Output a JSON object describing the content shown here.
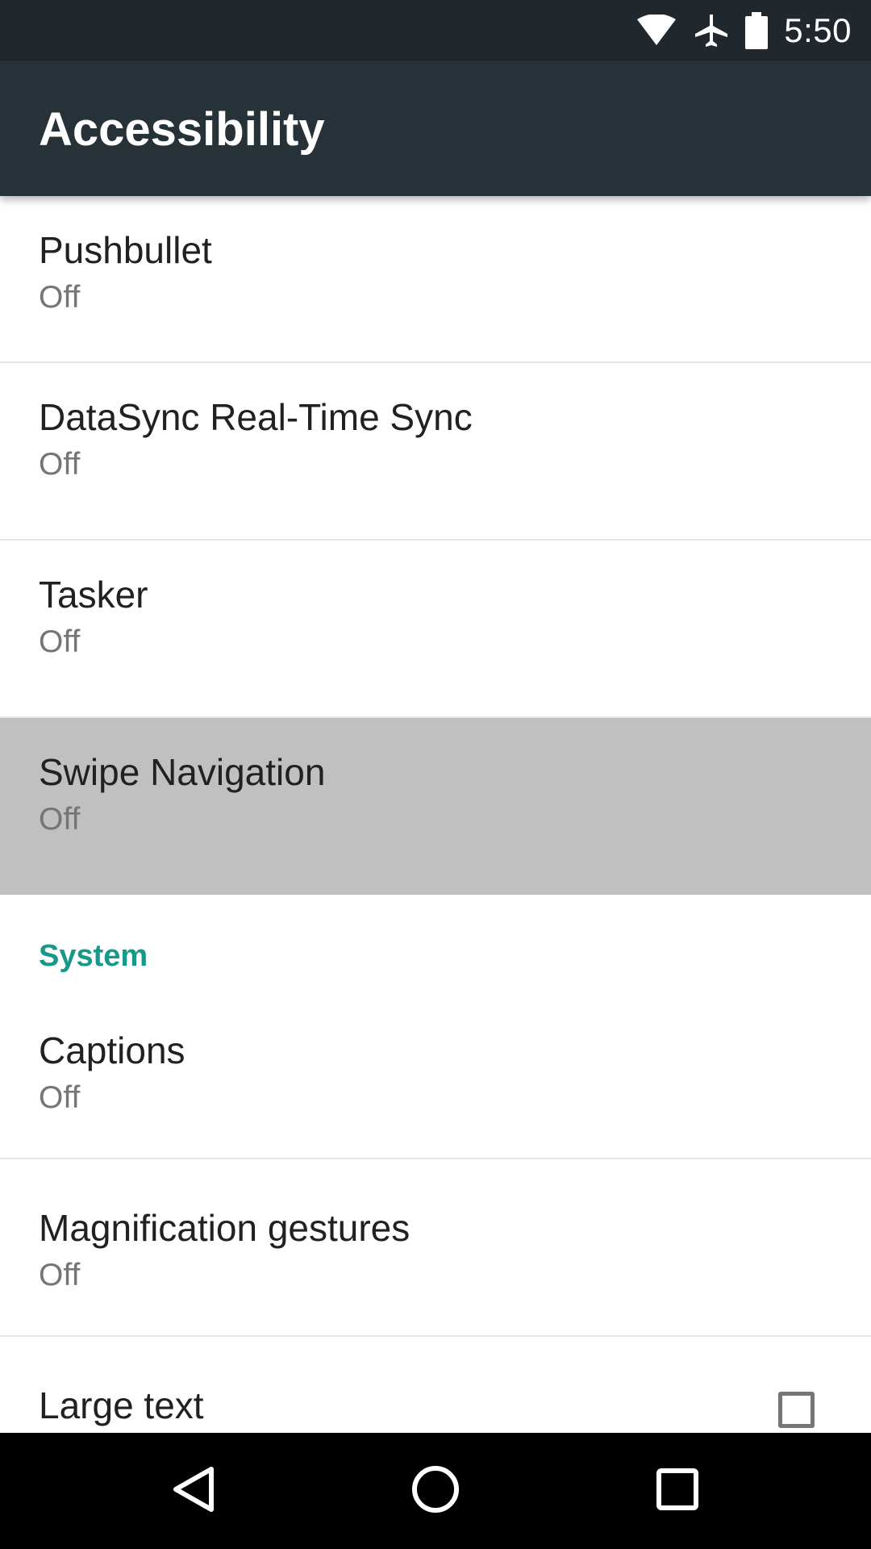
{
  "status_bar": {
    "time": "5:50",
    "icons": [
      "wifi-icon",
      "airplane-mode-icon",
      "battery-icon"
    ]
  },
  "app_bar": {
    "title": "Accessibility"
  },
  "services": [
    {
      "title": "Pushbullet",
      "summary": "Off"
    },
    {
      "title": "DataSync Real-Time Sync",
      "summary": "Off"
    },
    {
      "title": "Tasker",
      "summary": "Off"
    },
    {
      "title": "Swipe Navigation",
      "summary": "Off"
    }
  ],
  "system": {
    "header": "System",
    "items": [
      {
        "title": "Captions",
        "summary": "Off"
      },
      {
        "title": "Magnification gestures",
        "summary": "Off"
      },
      {
        "title": "Large text",
        "checked": false
      }
    ]
  },
  "nav_bar": {
    "icons": [
      "back-icon",
      "home-icon",
      "recents-icon"
    ]
  },
  "colors": {
    "status_bar": "#20282d",
    "app_bar": "#263238",
    "accent": "#16998a",
    "pressed_row": "#c0c0c0"
  }
}
